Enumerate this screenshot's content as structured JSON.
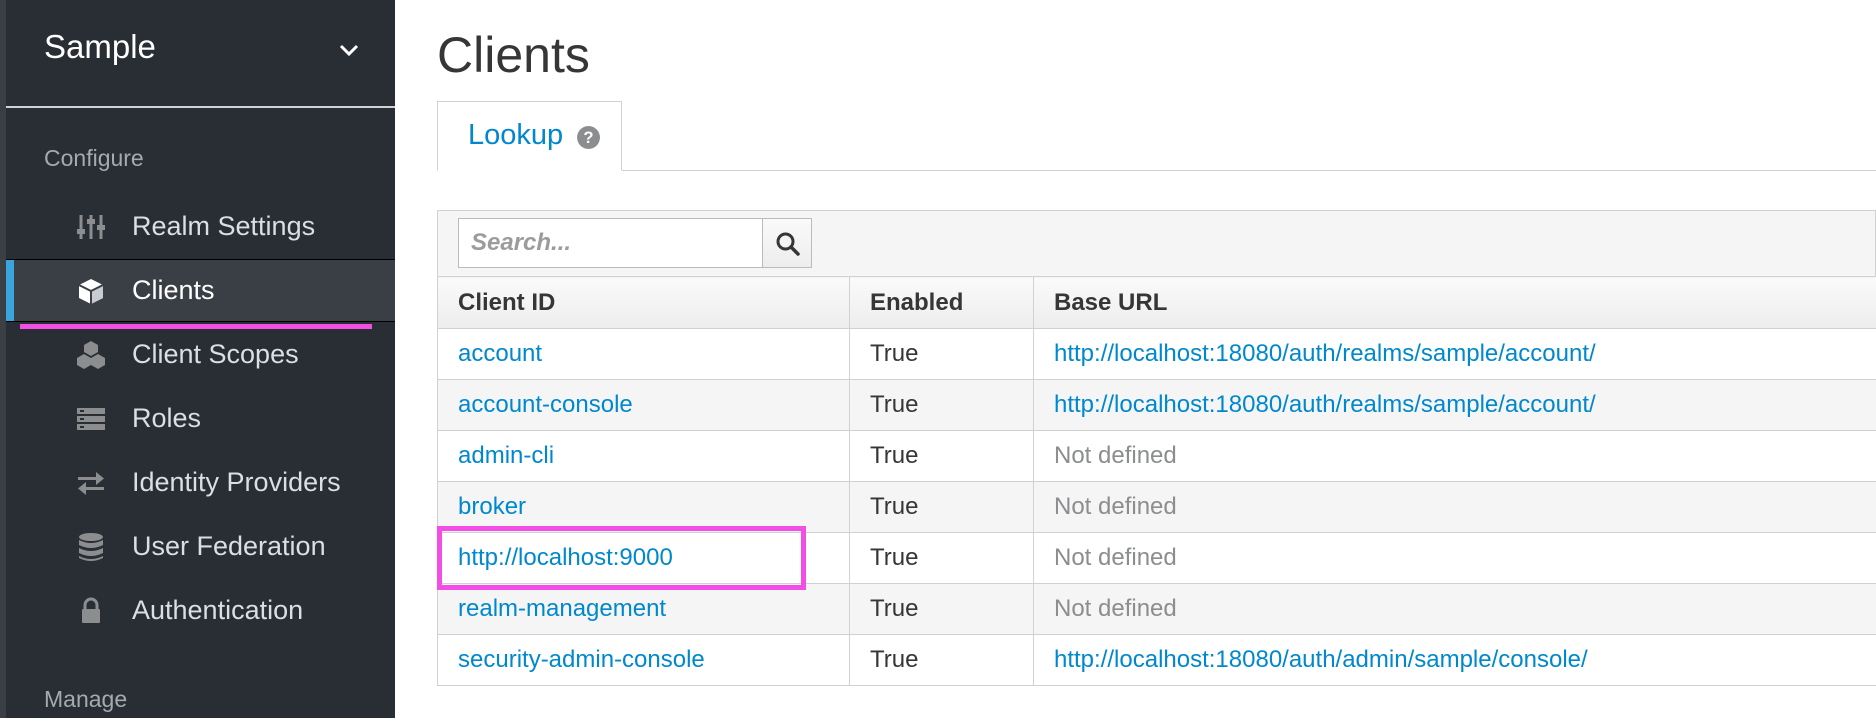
{
  "sidebar": {
    "realm": "Sample",
    "configure_label": "Configure",
    "manage_label": "Manage",
    "items": [
      {
        "label": "Realm Settings",
        "icon": "sliders-icon"
      },
      {
        "label": "Clients",
        "icon": "cube-icon",
        "active": true
      },
      {
        "label": "Client Scopes",
        "icon": "cubes-icon"
      },
      {
        "label": "Roles",
        "icon": "list-icon"
      },
      {
        "label": "Identity Providers",
        "icon": "exchange-icon"
      },
      {
        "label": "User Federation",
        "icon": "database-icon"
      },
      {
        "label": "Authentication",
        "icon": "lock-icon"
      }
    ]
  },
  "main": {
    "title": "Clients",
    "tabs": [
      {
        "label": "Lookup"
      }
    ],
    "search": {
      "placeholder": "Search...",
      "value": ""
    },
    "table": {
      "headers": [
        "Client ID",
        "Enabled",
        "Base URL"
      ],
      "rows": [
        {
          "client_id": "account",
          "enabled": "True",
          "base_url": "http://localhost:18080/auth/realms/sample/account/",
          "defined": true
        },
        {
          "client_id": "account-console",
          "enabled": "True",
          "base_url": "http://localhost:18080/auth/realms/sample/account/",
          "defined": true
        },
        {
          "client_id": "admin-cli",
          "enabled": "True",
          "base_url": "Not defined",
          "defined": false
        },
        {
          "client_id": "broker",
          "enabled": "True",
          "base_url": "Not defined",
          "defined": false
        },
        {
          "client_id": "http://localhost:9000",
          "enabled": "True",
          "base_url": "Not defined",
          "defined": false
        },
        {
          "client_id": "realm-management",
          "enabled": "True",
          "base_url": "Not defined",
          "defined": false
        },
        {
          "client_id": "security-admin-console",
          "enabled": "True",
          "base_url": "http://localhost:18080/auth/admin/sample/console/",
          "defined": true
        }
      ]
    }
  },
  "colors": {
    "sidebar_bg": "#292e34",
    "active_item_bg": "#393f44",
    "active_accent": "#39a5dc",
    "link": "#0088ce",
    "highlight": "#f24ee6"
  }
}
